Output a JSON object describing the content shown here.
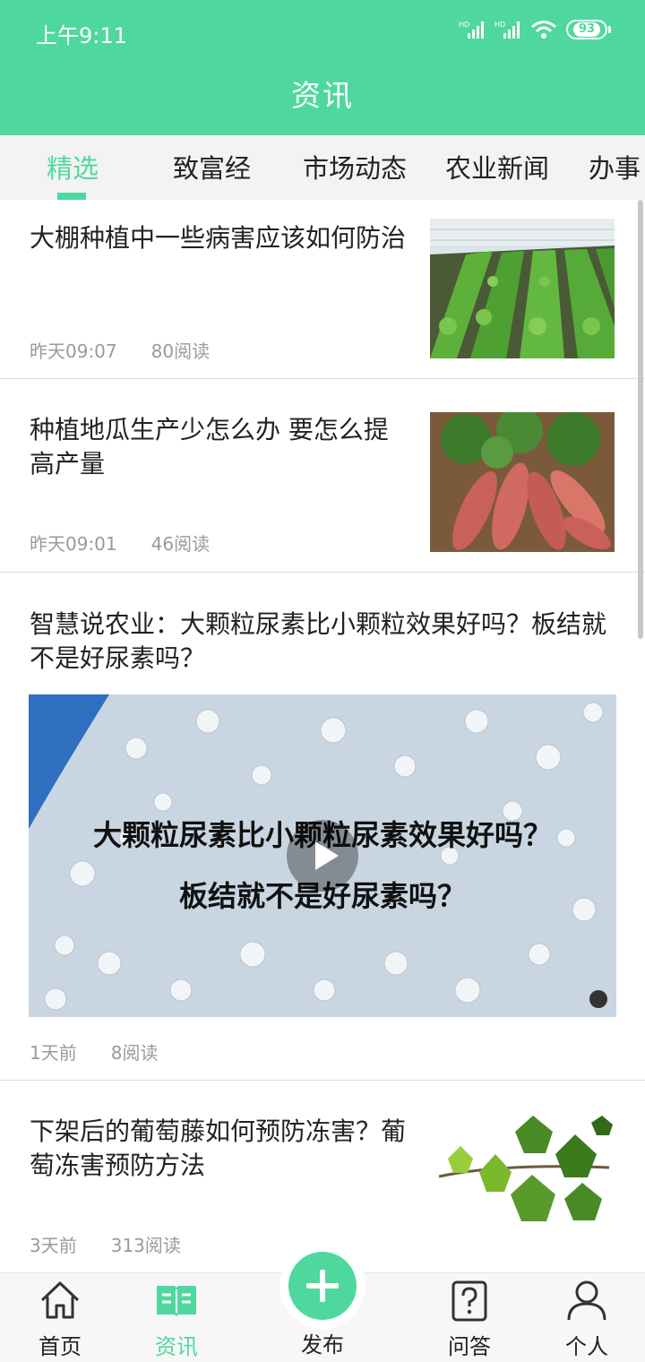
{
  "status_bar": {
    "time": "上午9:11",
    "battery": "93",
    "signal_label": "HD"
  },
  "header": {
    "title": "资讯"
  },
  "tabs": [
    {
      "label": "精选",
      "active": true
    },
    {
      "label": "致富经"
    },
    {
      "label": "市场动态"
    },
    {
      "label": "农业新闻"
    },
    {
      "label": "办事"
    }
  ],
  "articles": [
    {
      "title": "大棚种植中一些病害应该如何防治",
      "time": "昨天09:07",
      "reads": "80阅读",
      "image": "greenhouse-crops"
    },
    {
      "title": "种植地瓜生产少怎么办 要怎么提高产量",
      "time": "昨天09:01",
      "reads": "46阅读",
      "image": "sweet-potatoes"
    },
    {
      "title": "智慧说农业：大颗粒尿素比小颗粒效果好吗？板结就不是好尿素吗？",
      "time": "1天前",
      "reads": "8阅读",
      "video": {
        "caption_line1": "大颗粒尿素比小颗粒尿素效果好吗？",
        "caption_line2": "板结就不是好尿素吗？"
      }
    },
    {
      "title": "下架后的葡萄藤如何预防冻害？葡萄冻害预防方法",
      "time": "3天前",
      "reads": "313阅读",
      "image": "grape-leaves"
    }
  ],
  "bottom_nav": [
    {
      "label": "首页",
      "icon": "home-icon"
    },
    {
      "label": "资讯",
      "icon": "news-book-icon",
      "active": true
    },
    {
      "label": "发布",
      "icon": "plus-icon"
    },
    {
      "label": "问答",
      "icon": "question-icon"
    },
    {
      "label": "个人",
      "icon": "person-icon"
    }
  ],
  "colors": {
    "accent": "#4fd89e",
    "divider": "#dcdcdc",
    "meta_text": "#9a9a9a"
  }
}
